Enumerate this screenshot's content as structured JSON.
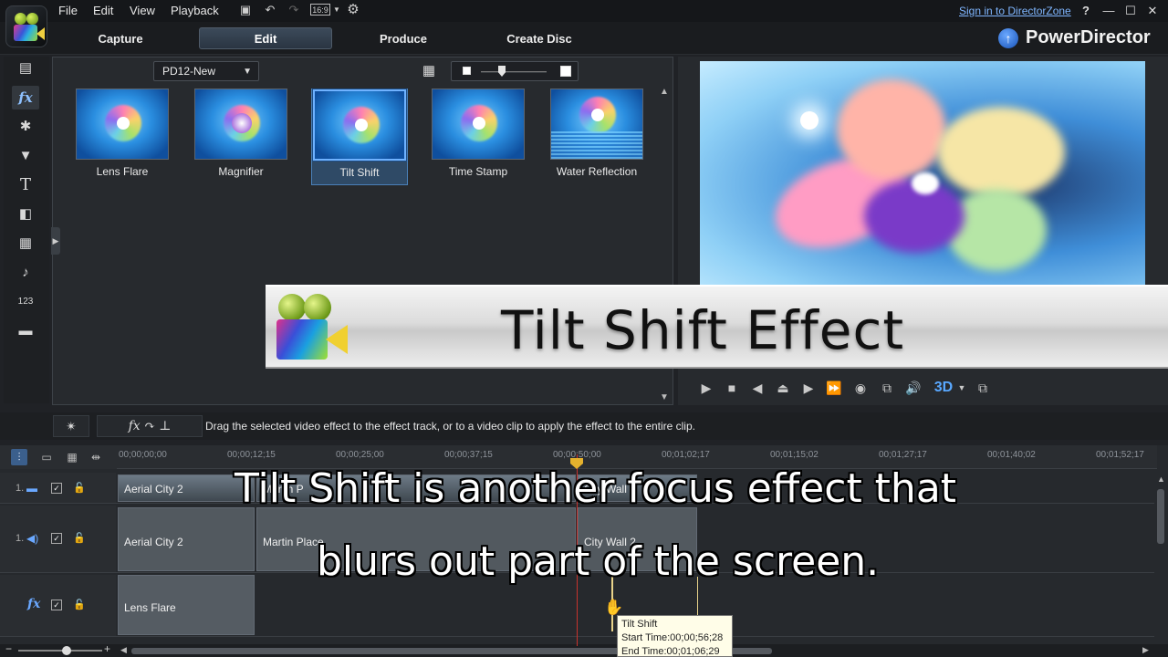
{
  "menu": {
    "items": [
      "File",
      "Edit",
      "View",
      "Playback"
    ],
    "aspect_ratio": "16:9",
    "signin_link": "Sign in to DirectorZone",
    "help": "?"
  },
  "modes": {
    "capture": "Capture",
    "edit": "Edit",
    "produce": "Produce",
    "create_disc": "Create Disc"
  },
  "brand": {
    "name": "PowerDirector"
  },
  "library": {
    "category": "PD12-New",
    "effects": [
      {
        "label": "Lens Flare",
        "selected": false
      },
      {
        "label": "Magnifier",
        "selected": false
      },
      {
        "label": "Tilt Shift",
        "selected": true
      },
      {
        "label": "Time Stamp",
        "selected": false
      },
      {
        "label": "Water Reflection",
        "selected": false
      }
    ]
  },
  "banner": {
    "title": "Tilt Shift Effect"
  },
  "hint": {
    "text": "Drag the selected video effect to the effect track, or to a video clip to apply the effect to the entire clip."
  },
  "ruler": {
    "ticks": [
      "00;00;00;00",
      "00;00;12;15",
      "00;00;25;00",
      "00;00;37;15",
      "00;00;50;00",
      "00;01;02;17",
      "00;01;15;02",
      "00;01;27;17",
      "00;01;40;02",
      "00;01;52;17"
    ]
  },
  "tracks": {
    "video": {
      "number": "1.",
      "clips": [
        "Aerial City 2",
        "Martin P",
        "City Wall 2"
      ]
    },
    "audio": {
      "number": "1.",
      "clips": [
        "Aerial City 2",
        "Martin Place",
        "City Wall 2"
      ]
    },
    "fx": {
      "label": "fx",
      "clips": [
        "Lens Flare"
      ]
    }
  },
  "tooltip": {
    "title": "Tilt Shift",
    "start": "Start Time:00;00;56;28",
    "end": "End Time:00;01;06;29"
  },
  "subtitles": {
    "line1": "Tilt Shift is another focus effect that",
    "line2": "blurs out part of the screen."
  }
}
